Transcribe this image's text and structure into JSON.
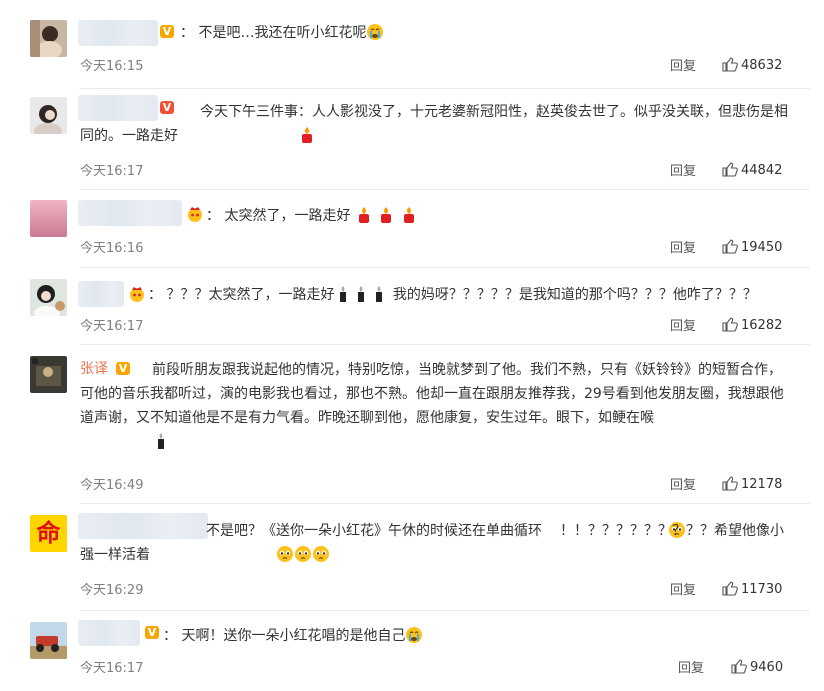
{
  "colors": {
    "accent_name": "#eb7350",
    "verified": "#f7a600",
    "time": "#808080",
    "separator": "#eaeaea"
  },
  "labels": {
    "reply": "回复",
    "colon": "："
  },
  "comments": [
    {
      "name": "",
      "text": "不是吧…我还在听小红花呢",
      "time": "今天16:15",
      "likes": "48632"
    },
    {
      "name": "",
      "text": "今天下午三件事：人人影视没了，十元老婆新冠阳性，赵英俊去世了。似乎没关联，但悲伤是相同的。一路走好",
      "time": "今天16:17",
      "likes": "44842"
    },
    {
      "name": "",
      "text": "太突然了，一路走好",
      "time": "今天16:16",
      "likes": "19450"
    },
    {
      "name": "",
      "text": "？？？太突然了，一路走好",
      "text2": "我的妈呀？？？？？是我知道的那个吗？？？他咋了？？？",
      "time": "今天16:17",
      "likes": "16282"
    },
    {
      "name": "张译",
      "text": "前段听朋友跟我说起他的情况，特别吃惊，当晚就梦到了他。我们不熟，只有《妖铃铃》的短暂合作，可他的音乐我都听过，演的电影我也看过，那也不熟。他却一直在跟朋友推荐我，29号看到他发朋友圈，我想跟他道声谢，又不知道他是不是有力气看。昨晚还聊到他，愿他康复，安生过年。眼下，如鲠在喉",
      "time": "今天16:49",
      "likes": "12178"
    },
    {
      "name": "",
      "text": "不是吧？《送你一朵小红花》午休的时候还在单曲循环",
      "text2": "！！？？？？？？？？？希望他像小强一样活着",
      "time": "今天16:29",
      "likes": "11730",
      "avatar_char": "命"
    },
    {
      "name": "",
      "text": "天啊！送你一朵小红花唱的是他自己",
      "time": "今天16:17",
      "likes": "9460"
    }
  ]
}
